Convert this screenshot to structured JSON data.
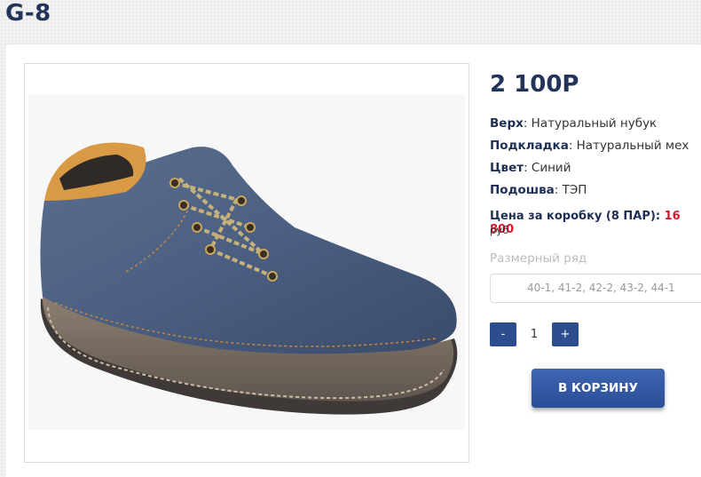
{
  "page": {
    "title": "G-8"
  },
  "product": {
    "image_alt": "blue nubuck shoe",
    "price": "2 100Р",
    "specs": [
      {
        "label": "Верх",
        "value": ": Натуральный нубук"
      },
      {
        "label": "Подкладка",
        "value": ": Натуральный мех"
      },
      {
        "label": "Цвет",
        "value": ": Синий"
      },
      {
        "label": "Подошва",
        "value": ": ТЭП"
      }
    ],
    "box_price": {
      "label": "Цена за коробку (8 ПАР):",
      "value": "16 800",
      "unit": "руб"
    },
    "sizes": {
      "label": "Размерный ряд",
      "value": "40-1, 41-2, 42-2, 43-2, 44-1"
    },
    "quantity": {
      "minus": "-",
      "value": "1",
      "plus": "+"
    },
    "cart_button": "В КОРЗИНУ"
  },
  "colors": {
    "accent": "#2c4e8e",
    "title": "#23345a",
    "price_red": "#d6162b"
  }
}
